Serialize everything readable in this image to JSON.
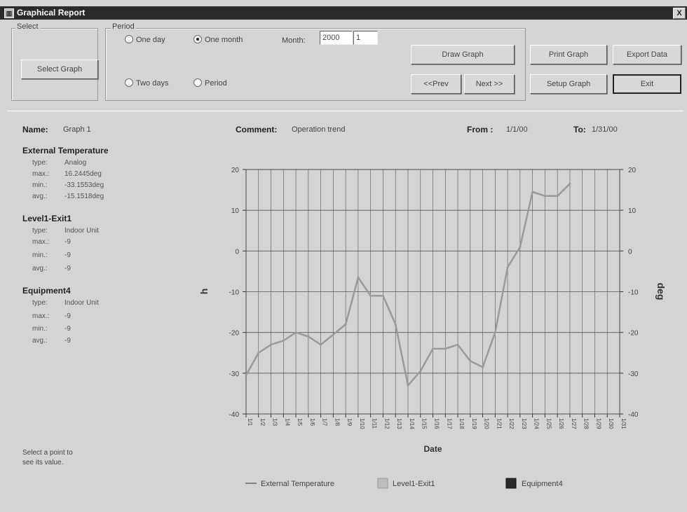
{
  "window": {
    "title": "Graphical Report",
    "close_glyph": "X"
  },
  "select_group": {
    "label": "Select",
    "button": "Select Graph"
  },
  "period_group": {
    "label": "Period",
    "options": [
      "One day",
      "One month",
      "Two days",
      "Period"
    ],
    "selected": "One month",
    "month_label": "Month:",
    "year_value": "2000",
    "month_value": "1"
  },
  "buttons": {
    "draw_graph": "Draw Graph",
    "prev": "<<Prev",
    "next": "Next >>",
    "print_graph": "Print Graph",
    "setup_graph": "Setup Graph",
    "export_data": "Export Data",
    "exit": "Exit"
  },
  "info": {
    "name_label": "Name:",
    "name_value": "Graph 1",
    "comment_label": "Comment:",
    "comment_value": "Operation trend",
    "from_label": "From :",
    "from_value": "1/1/00",
    "to_label": "To:",
    "to_value": "1/31/00"
  },
  "series_info": [
    {
      "name": "External Temperature",
      "rows": [
        [
          "type:",
          "Analog"
        ],
        [
          "max.:",
          "16.2445deg"
        ],
        [
          "min.:",
          "-33.1553deg"
        ],
        [
          "avg.:",
          "-15.1518deg"
        ]
      ]
    },
    {
      "name": "Level1-Exit1",
      "rows": [
        [
          "type:",
          "Indoor Unit"
        ],
        [
          "max.:",
          "-9"
        ],
        [
          "min.:",
          "-9"
        ],
        [
          "avg.:",
          "-9"
        ]
      ]
    },
    {
      "name": "Equipment4",
      "rows": [
        [
          "type:",
          "Indoor Unit"
        ],
        [
          "max.:",
          "-9"
        ],
        [
          "min.:",
          "-9"
        ],
        [
          "avg.:",
          "-9"
        ]
      ]
    }
  ],
  "hint": {
    "line1": "Select a point to",
    "line2": "see its value."
  },
  "colors": {
    "grid": "#555555",
    "line": "#9a9a9a",
    "plot_bg": "#d4d4d4"
  },
  "chart_data": {
    "type": "line",
    "xlabel": "Date",
    "ylabel_left": "h",
    "ylabel_right": "deg",
    "ylim": [
      -40,
      20
    ],
    "yticks": [
      20,
      10,
      0,
      -10,
      -20,
      -30,
      -40
    ],
    "grid": true,
    "legend_position": "bottom",
    "categories": [
      "1/1",
      "1/2",
      "1/3",
      "1/4",
      "1/5",
      "1/6",
      "1/7",
      "1/8",
      "1/9",
      "1/10",
      "1/11",
      "1/12",
      "1/13",
      "1/14",
      "1/15",
      "1/16",
      "1/17",
      "1/18",
      "1/19",
      "1/20",
      "1/21",
      "1/22",
      "1/23",
      "1/24",
      "1/25",
      "1/26",
      "1/27",
      "1/28",
      "1/29",
      "1/30",
      "1/31"
    ],
    "series": [
      {
        "name": "External Temperature",
        "values": [
          -30.5,
          -25,
          -23,
          -22,
          -20,
          -21,
          -23,
          -20.5,
          -18,
          -6.5,
          -11,
          -11,
          -18,
          -33,
          -29.5,
          -24,
          -24,
          -23,
          -27,
          -28.5,
          -20,
          -4,
          1,
          14.5,
          13.5,
          13.5,
          16.5,
          null,
          null,
          null,
          null
        ]
      },
      {
        "name": "Level1-Exit1",
        "values": []
      },
      {
        "name": "Equipment4",
        "values": []
      }
    ]
  }
}
